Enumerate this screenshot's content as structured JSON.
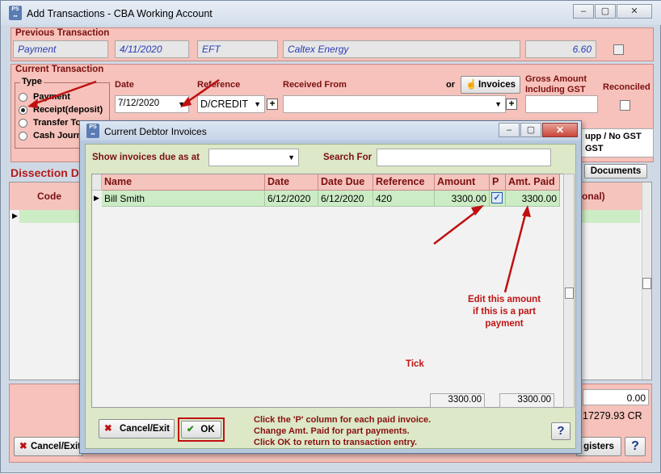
{
  "window": {
    "title": "Add Transactions - CBA Working Account"
  },
  "previous": {
    "section_label": "Previous Transaction",
    "type": "Payment",
    "date": "4/11/2020",
    "method": "EFT",
    "payee": "Caltex Energy",
    "amount": "6.60"
  },
  "current": {
    "section_label": "Current Transaction",
    "type_label": "Type",
    "types": [
      "Payment",
      "Receipt(deposit)",
      "Transfer To",
      "Cash Journal"
    ],
    "date_label": "Date",
    "date_value": "7/12/2020",
    "reference_label": "Reference",
    "reference_value": "D/CREDIT",
    "received_from_label": "Received From",
    "or_label": "or",
    "invoices_button": "Invoices",
    "gross_label": "Gross Amount Including GST",
    "reconciled_label": "Reconciled",
    "gst_note": "upp / No GST",
    "gst_note2": "GST",
    "documents_button": "Documents"
  },
  "dissection": {
    "label": "Dissection D",
    "code_header": "Code",
    "right_header": "onal)"
  },
  "bottom": {
    "amount": "0.00",
    "balance": "17279.93 CR",
    "cancel_exit": "Cancel/Exit",
    "registers": "gisters"
  },
  "dialog": {
    "title": "Current Debtor Invoices",
    "show_label": "Show invoices due as at",
    "search_label": "Search For",
    "columns": [
      "Name",
      "Date",
      "Date Due",
      "Reference",
      "Amount",
      "P",
      "Amt. Paid"
    ],
    "rows": [
      {
        "name": "Bill Smith",
        "date": "6/12/2020",
        "date_due": "6/12/2020",
        "reference": "420",
        "amount": "3300.00",
        "paid": true,
        "amt_paid": "3300.00"
      }
    ],
    "total_amount": "3300.00",
    "total_paid": "3300.00",
    "cancel_button": "Cancel/Exit",
    "ok_button": "OK",
    "instructions": [
      "Click the 'P' column for each paid invoice.",
      "Change Amt. Paid for part payments.",
      "Click OK to return to transaction entry."
    ],
    "annotation_tick": "Tick",
    "annotation_edit": [
      "Edit this amount",
      "if this is a part",
      "payment"
    ]
  }
}
